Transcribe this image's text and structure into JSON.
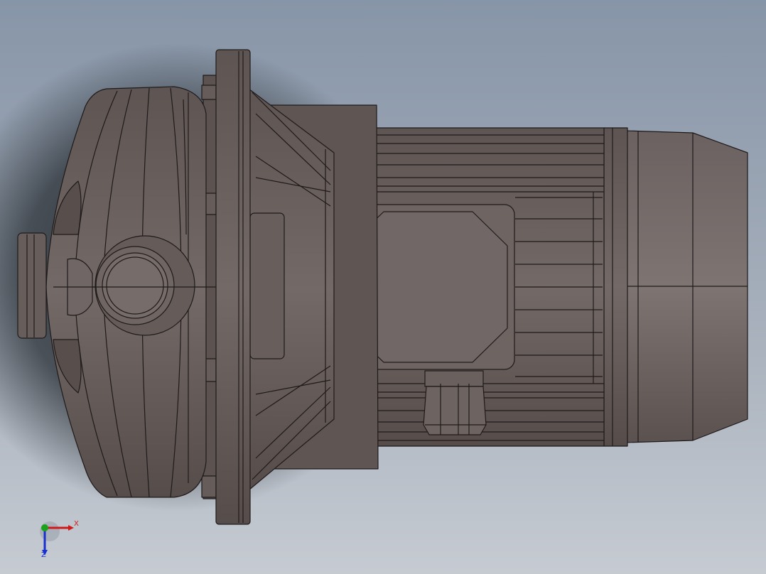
{
  "viewport": {
    "background_top": "#8896a9",
    "background_bottom": "#c4c9d0",
    "shadow_color": "#1c2126",
    "model_fill": "#6d6361",
    "model_fill_light": "#7a706d",
    "model_fill_dark": "#584f4d",
    "edge_color": "#1e1a1a"
  },
  "triad": {
    "x_label": "X",
    "z_label": "Z",
    "x_color": "#d01a1a",
    "y_color": "#1aa31a",
    "z_color": "#1a2fd0"
  }
}
